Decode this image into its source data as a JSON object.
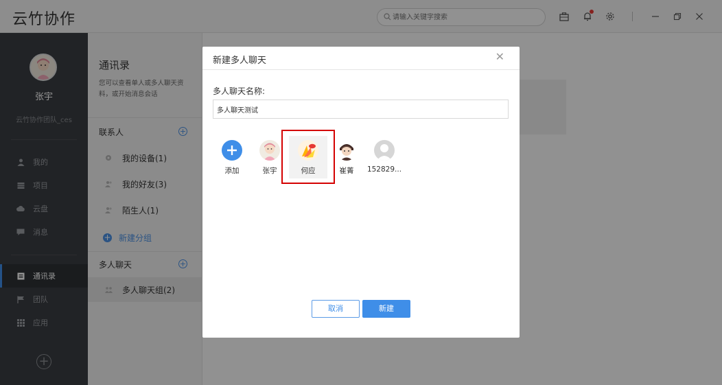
{
  "app": {
    "title": "云竹协作",
    "search_placeholder": "请输入关键字搜索"
  },
  "titlebar_icons": [
    "briefcase-icon",
    "bell-icon",
    "gear-icon",
    "minimize-icon",
    "restore-icon",
    "close-icon"
  ],
  "sidebar": {
    "user_name": "张宇",
    "team_name": "云竹协作团队_ces",
    "items": [
      {
        "label": "我的",
        "icon": "person-icon",
        "active": false
      },
      {
        "label": "项目",
        "icon": "project-icon",
        "active": false
      },
      {
        "label": "云盘",
        "icon": "cloud-icon",
        "active": false
      },
      {
        "label": "消息",
        "icon": "message-icon",
        "active": false
      },
      {
        "label": "通讯录",
        "icon": "contacts-icon",
        "active": true
      },
      {
        "label": "团队",
        "icon": "flag-icon",
        "active": false
      },
      {
        "label": "应用",
        "icon": "apps-grid-icon",
        "active": false
      }
    ]
  },
  "contacts": {
    "title": "通讯录",
    "description": "您可以查看单人或多人聊天资料，或开始消息会话",
    "contacts_section": "联系人",
    "contact_items": [
      {
        "label": "我的设备(1)",
        "icon": "device-icon"
      },
      {
        "label": "我的好友(3)",
        "icon": "friends-icon"
      },
      {
        "label": "陌生人(1)",
        "icon": "stranger-icon"
      }
    ],
    "new_group_label": "新建分组",
    "group_chat_section": "多人聊天",
    "group_items": [
      {
        "label": "多人聊天组(2)",
        "icon": "group-icon",
        "selected": true
      }
    ]
  },
  "modal": {
    "title": "新建多人聊天",
    "name_label": "多人聊天名称:",
    "name_value": "多人聊天测试",
    "members": [
      {
        "name": "添加",
        "type": "add"
      },
      {
        "name": "张宇",
        "type": "avatar-girl"
      },
      {
        "name": "何应",
        "type": "avatar-logo",
        "highlighted": true
      },
      {
        "name": "崔菁",
        "type": "avatar-dark"
      },
      {
        "name": "152829...",
        "type": "avatar-default"
      }
    ],
    "cancel_label": "取消",
    "create_label": "新建"
  },
  "colors": {
    "accent": "#3f8ee8",
    "sidebar_bg": "#3a3d42",
    "highlight_border": "#d40000"
  }
}
